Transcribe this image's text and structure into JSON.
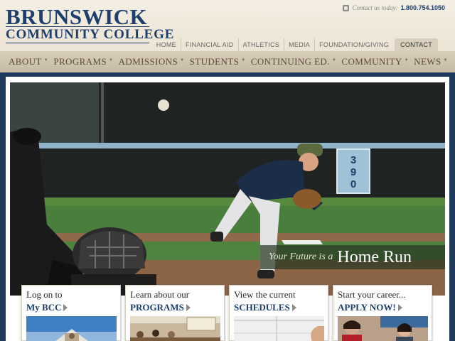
{
  "header": {
    "logo_line1": "BRUNSWICK",
    "logo_line2": "COMMUNITY COLLEGE",
    "contact_label": "Contact us today:",
    "contact_phone": "1.800.754.1050",
    "brand_color": "#1c3f6e"
  },
  "topnav": {
    "items": [
      "HOME",
      "FINANCIAL AID",
      "ATHLETICS",
      "MEDIA",
      "FOUNDATION/GIVING",
      "CONTACT"
    ],
    "active": "CONTACT"
  },
  "mainnav": {
    "items": [
      "ABOUT",
      "PROGRAMS",
      "ADMISSIONS",
      "STUDENTS",
      "CONTINUING ED.",
      "COMMUNITY",
      "NEWS"
    ]
  },
  "hero": {
    "tagline_small": "Your Future is a",
    "tagline_big": "Home Run",
    "sign_digits": [
      "3",
      "9",
      "0"
    ]
  },
  "cards": [
    {
      "line1": "Log on to",
      "line2": "My BCC",
      "image": "campus-building-photo"
    },
    {
      "line1": "Learn about our",
      "line2": "PROGRAMS",
      "image": "classroom-photo"
    },
    {
      "line1": "View the current",
      "line2": "SCHEDULES",
      "image": "calendar-photo"
    },
    {
      "line1": "Start your career...",
      "line2": "APPLY NOW!",
      "image": "students-photo"
    }
  ],
  "icons": {
    "phone": "phone-icon",
    "arrow": "arrow-right-icon",
    "caret": "caret-down-icon"
  }
}
